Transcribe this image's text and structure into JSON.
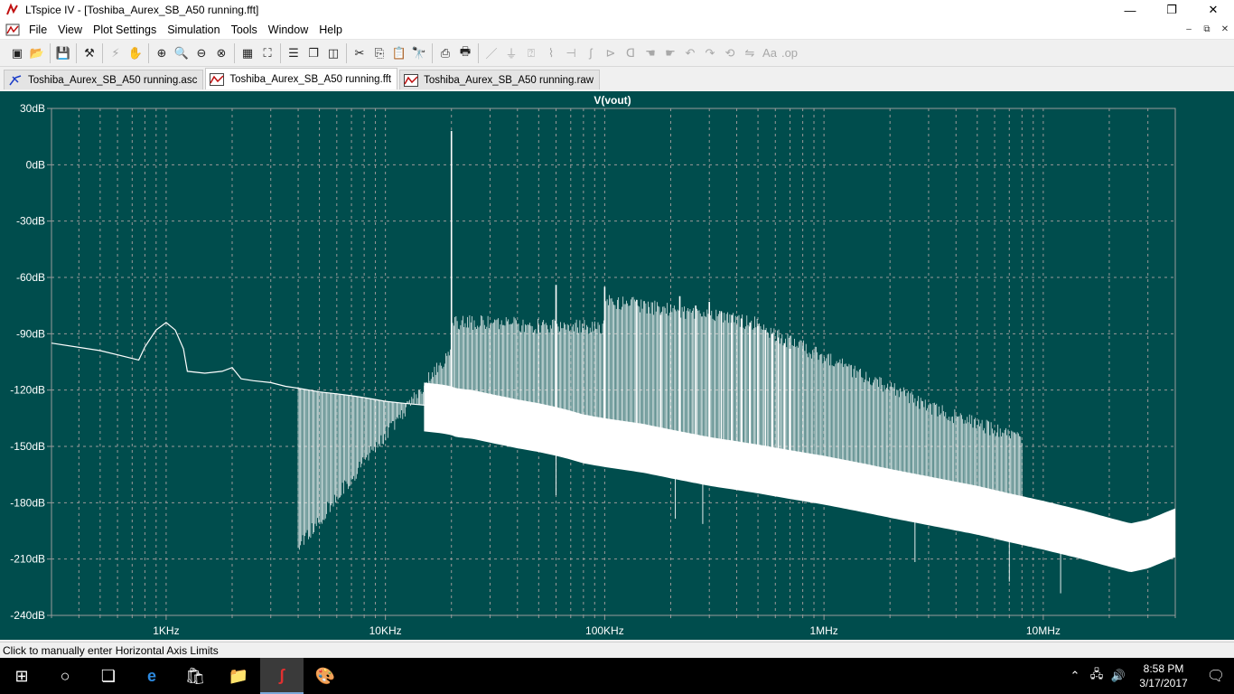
{
  "window": {
    "title": "LTspice IV - [Toshiba_Aurex_SB_A50 running.fft]",
    "minimize": "—",
    "maximize": "❐",
    "close": "✕"
  },
  "menu": {
    "items": [
      "File",
      "View",
      "Plot Settings",
      "Simulation",
      "Tools",
      "Window",
      "Help"
    ],
    "mdi": [
      "–",
      "⧉",
      "✕"
    ]
  },
  "tabs": [
    {
      "label": "Toshiba_Aurex_SB_A50 running.asc",
      "icon": "schematic-icon"
    },
    {
      "label": "Toshiba_Aurex_SB_A50 running.fft",
      "icon": "waveform-icon"
    },
    {
      "label": "Toshiba_Aurex_SB_A50 running.raw",
      "icon": "waveform-icon"
    }
  ],
  "status": {
    "text": "Click to manually enter Horizontal Axis Limits"
  },
  "taskbar": {
    "time": "8:58 PM",
    "date": "3/17/2017"
  },
  "colors": {
    "plot_bg": "#004d4d",
    "grid": "#9a9a9a",
    "trace": "#ffffff",
    "axis_text": "#ffffff"
  },
  "chart_data": {
    "type": "line",
    "title": "V(vout)",
    "x_scale": "log",
    "xlim_hz": [
      300,
      40000000
    ],
    "ylim_db": [
      -240,
      30
    ],
    "y_ticks": [
      {
        "value": 30,
        "label": "30dB"
      },
      {
        "value": 0,
        "label": "0dB"
      },
      {
        "value": -30,
        "label": "-30dB"
      },
      {
        "value": -60,
        "label": "-60dB"
      },
      {
        "value": -90,
        "label": "-90dB"
      },
      {
        "value": -120,
        "label": "-120dB"
      },
      {
        "value": -150,
        "label": "-150dB"
      },
      {
        "value": -180,
        "label": "-180dB"
      },
      {
        "value": -210,
        "label": "-210dB"
      },
      {
        "value": -240,
        "label": "-240dB"
      }
    ],
    "x_ticks": [
      {
        "value": 1000,
        "label": "1KHz"
      },
      {
        "value": 10000,
        "label": "10KHz"
      },
      {
        "value": 100000,
        "label": "100KHz"
      },
      {
        "value": 1000000,
        "label": "1MHz"
      },
      {
        "value": 10000000,
        "label": "10MHz"
      }
    ],
    "grid": true,
    "series": [
      {
        "x": [
          300,
          500,
          750,
          800,
          900,
          1000,
          1100,
          1200,
          1250,
          1500,
          1800,
          2000,
          2200,
          2500,
          3000,
          3500,
          4000,
          5000,
          6000,
          7000,
          8000,
          9000,
          10000,
          12000,
          15000,
          18000,
          20000,
          21000,
          25000,
          30000,
          40000,
          50000,
          60000,
          70000,
          80000,
          100000,
          150000,
          200000,
          300000,
          500000,
          700000,
          1000000,
          1500000,
          2000000,
          3000000,
          5000000,
          7000000,
          10000000,
          15000000,
          20000000,
          25000000,
          30000000,
          40000000
        ],
        "y": [
          -95,
          -99,
          -104,
          -97,
          -88,
          -84,
          -88,
          -98,
          -110,
          -111,
          -110,
          -108,
          -114,
          -115,
          -116,
          -118,
          -119,
          -121,
          -122,
          -123,
          -124,
          -125,
          -126,
          -127,
          -128,
          -129,
          -130,
          -131,
          -132,
          -134,
          -137,
          -139,
          -141,
          -143,
          -145,
          -147,
          -150,
          -153,
          -157,
          -161,
          -164,
          -167,
          -171,
          -174,
          -178,
          -183,
          -187,
          -191,
          -196,
          -200,
          -203,
          -201,
          -195
        ]
      }
    ],
    "peaks": {
      "x": [
        20000,
        60000,
        100000,
        140000,
        180000,
        220000,
        260000,
        300000,
        340000,
        380000,
        420000,
        460000,
        500000,
        540000,
        580000,
        620000,
        660000,
        700000
      ],
      "y": [
        18,
        -64,
        -65,
        -72,
        -80,
        -70,
        -75,
        -73,
        -78,
        -80,
        -82,
        -84,
        -86,
        -88,
        -90,
        -92,
        -95,
        -98
      ]
    }
  }
}
